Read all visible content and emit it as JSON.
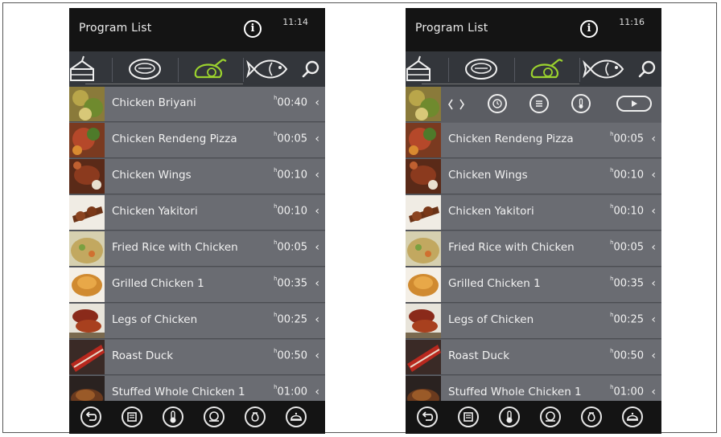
{
  "screens": [
    {
      "header": {
        "title": "Program List",
        "time": "11:14"
      },
      "items": [
        {
          "name": "Chicken Briyani",
          "duration": "00:40",
          "unit": "h"
        },
        {
          "name": "Chicken Rendeng Pizza",
          "duration": "00:05",
          "unit": "h"
        },
        {
          "name": "Chicken Wings",
          "duration": "00:10",
          "unit": "h"
        },
        {
          "name": "Chicken Yakitori",
          "duration": "00:10",
          "unit": "h"
        },
        {
          "name": "Fried Rice with Chicken",
          "duration": "00:05",
          "unit": "h"
        },
        {
          "name": "Grilled Chicken 1",
          "duration": "00:35",
          "unit": "h"
        },
        {
          "name": "Legs of Chicken",
          "duration": "00:25",
          "unit": "h"
        },
        {
          "name": "Roast Duck",
          "duration": "00:50",
          "unit": "h"
        },
        {
          "name": "Stuffed Whole Chicken 1",
          "duration": "01:00",
          "unit": "h"
        }
      ]
    },
    {
      "header": {
        "title": "Program List",
        "time": "11:16"
      },
      "items": [
        {
          "name": "",
          "duration": "",
          "unit": ""
        },
        {
          "name": "Chicken Rendeng Pizza",
          "duration": "00:05",
          "unit": "h"
        },
        {
          "name": "Chicken Wings",
          "duration": "00:10",
          "unit": "h"
        },
        {
          "name": "Chicken Yakitori",
          "duration": "00:10",
          "unit": "h"
        },
        {
          "name": "Fried Rice with Chicken",
          "duration": "00:05",
          "unit": "h"
        },
        {
          "name": "Grilled Chicken 1",
          "duration": "00:35",
          "unit": "h"
        },
        {
          "name": "Legs of Chicken",
          "duration": "00:25",
          "unit": "h"
        },
        {
          "name": "Roast Duck",
          "duration": "00:50",
          "unit": "h"
        },
        {
          "name": "Stuffed Whole Chicken 1",
          "duration": "01:00",
          "unit": "h"
        }
      ]
    }
  ],
  "common": {
    "info_glyph": "i",
    "chevron": "‹",
    "tabs": [
      "cake-icon",
      "meat-icon",
      "poultry-icon",
      "fish-icon",
      "search-icon"
    ],
    "active_tab": "poultry-icon",
    "bottom_icons": [
      "back-icon",
      "oven-icon",
      "temperature-icon",
      "plate-icon",
      "steam-icon",
      "cloche-icon"
    ],
    "action_icons": [
      "timer-icon",
      "details-icon",
      "temperature-icon",
      "play-icon"
    ],
    "accent_color": "#9bd22e"
  }
}
